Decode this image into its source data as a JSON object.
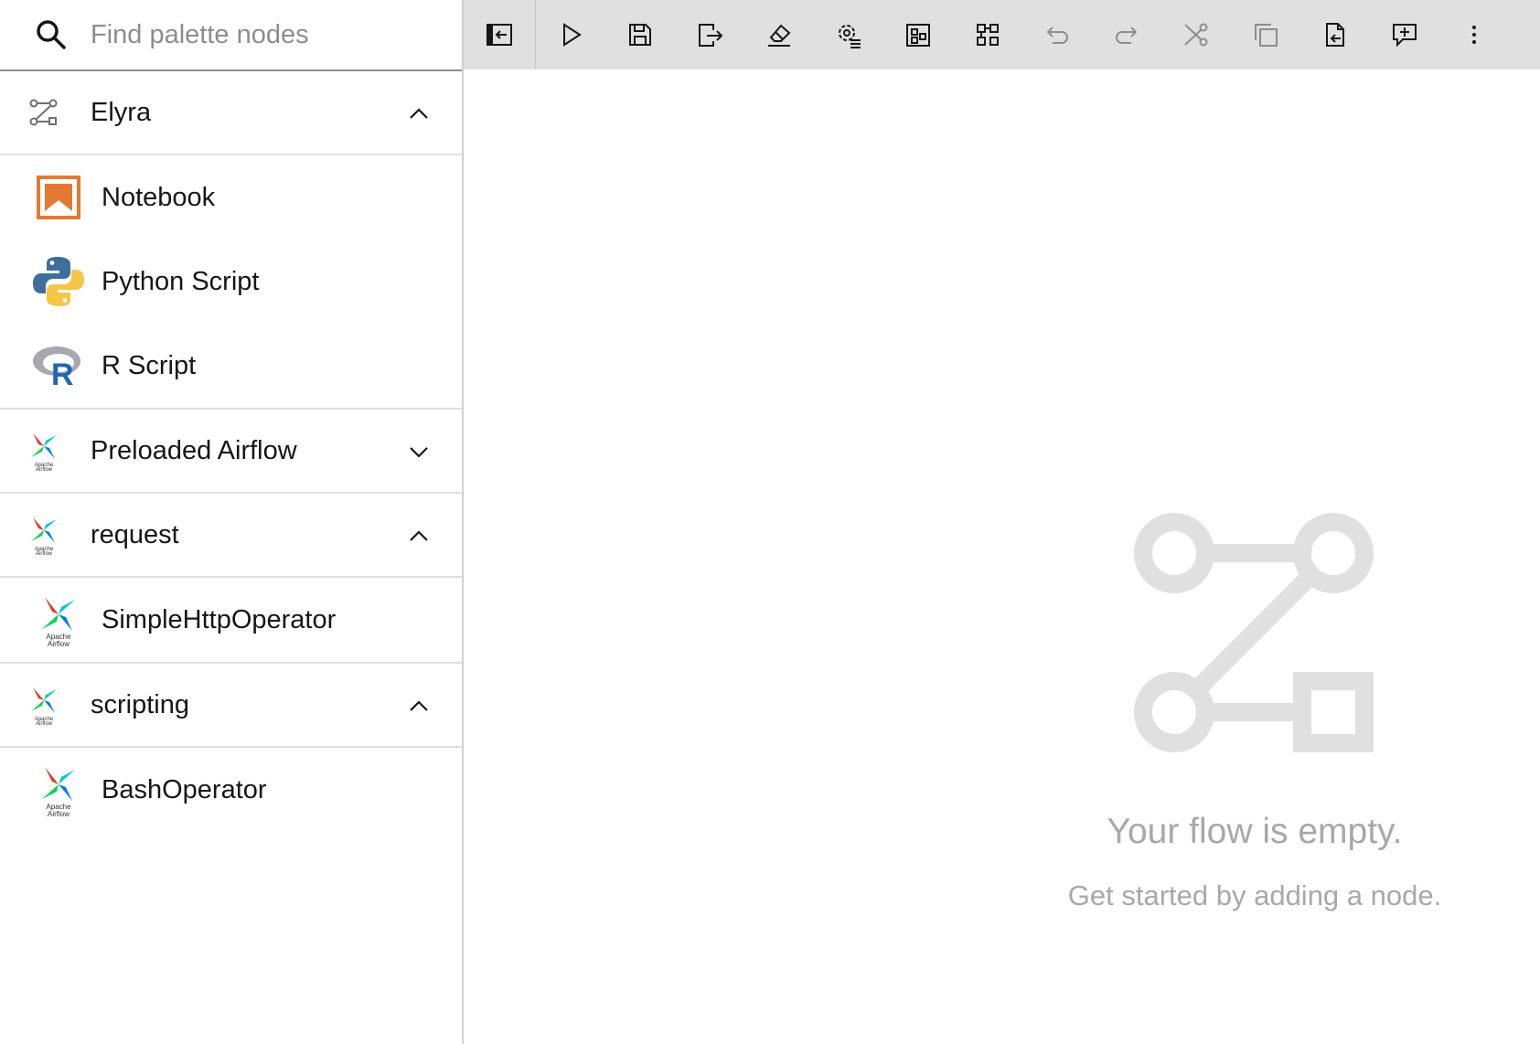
{
  "search": {
    "placeholder": "Find palette nodes"
  },
  "palette": {
    "elyra": {
      "label": "Elyra",
      "expanded": true,
      "items": [
        {
          "label": "Notebook",
          "icon": "notebook-icon"
        },
        {
          "label": "Python Script",
          "icon": "python-icon"
        },
        {
          "label": "R Script",
          "icon": "r-icon"
        }
      ]
    },
    "preloaded_airflow": {
      "label": "Preloaded Airflow",
      "expanded": false,
      "icon": "airflow-icon"
    },
    "request": {
      "label": "request",
      "expanded": true,
      "items": [
        {
          "label": "SimpleHttpOperator",
          "icon": "airflow-icon"
        }
      ]
    },
    "scripting": {
      "label": "scripting",
      "expanded": true,
      "items": [
        {
          "label": "BashOperator",
          "icon": "airflow-icon"
        }
      ]
    }
  },
  "airflow_logo_text": [
    "Apache",
    "Airflow"
  ],
  "toolbar": {
    "buttons": [
      "toggle-palette-icon",
      "run-icon",
      "save-icon",
      "export-icon",
      "clear-icon",
      "runtime-settings-icon",
      "arrange-horizontal-icon",
      "arrange-vertical-icon",
      "undo-icon",
      "redo-icon",
      "cut-icon",
      "copy-icon",
      "paste-icon",
      "add-comment-icon",
      "overflow-menu-icon"
    ]
  },
  "canvas": {
    "empty_title": "Your flow is empty.",
    "empty_subtitle": "Get started by adding a node."
  },
  "colors": {
    "toolbar_bg": "#e0e0e0",
    "empty_text": "#a8a8a8",
    "empty_graphic": "#e0e0e0",
    "notebook_orange": "#e37933"
  }
}
